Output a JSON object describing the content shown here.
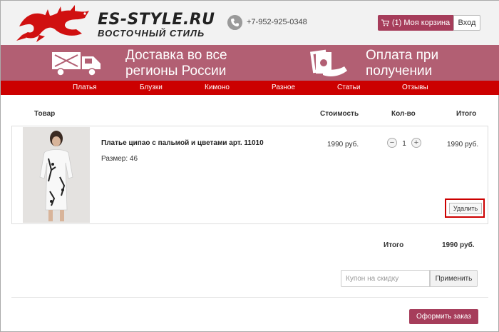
{
  "header": {
    "logo_title": "ES-STYLE.RU",
    "logo_subtitle": "ВОСТОЧНЫЙ СТИЛЬ",
    "phone": "+7-952-925-0348",
    "cart_label": "(1) Моя корзина",
    "login_label": "Вход"
  },
  "banner": {
    "delivery_line1": "Доставка во все",
    "delivery_line2": "регионы России",
    "payment_line1": "Оплата при",
    "payment_line2": "получении"
  },
  "nav": {
    "items": [
      "Платья",
      "Блузки",
      "Кимоно",
      "Разное",
      "Статьи",
      "Отзывы"
    ]
  },
  "cart_table": {
    "headers": {
      "product": "Товар",
      "price": "Стоимость",
      "qty": "Кол-во",
      "total": "Итого"
    },
    "item": {
      "name": "Платье ципао с пальмой и цветами арт. 11010",
      "size": "Размер: 46",
      "price": "1990 руб.",
      "qty": "1",
      "total": "1990 руб.",
      "delete_label": "Удалить"
    }
  },
  "summary": {
    "total_label": "Итого",
    "total_value": "1990 руб."
  },
  "coupon": {
    "placeholder": "Купон на скидку",
    "apply_label": "Применить"
  },
  "checkout": {
    "order_label": "Оформить заказ"
  },
  "colors": {
    "accent": "#a63d5b",
    "banner": "#b25f73",
    "nav": "#cc0000"
  }
}
